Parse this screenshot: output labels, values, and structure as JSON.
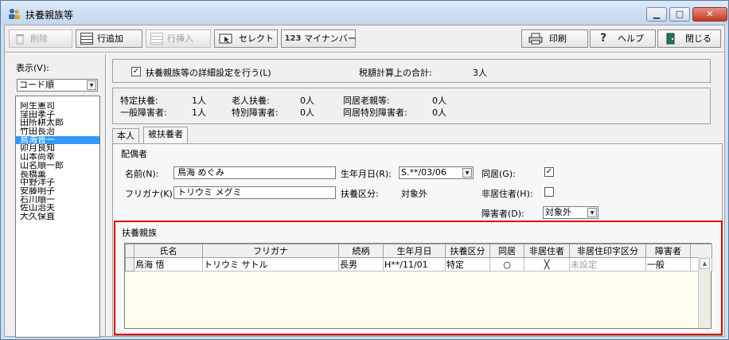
{
  "window": {
    "title": "扶養親族等",
    "icon": "app-icon",
    "controls": {
      "minimize": "▁",
      "maximize": "□",
      "close": "✕"
    }
  },
  "toolbar": {
    "delete": "削除",
    "add_row": "行追加",
    "insert_row": "行挿入",
    "select": "セレクト",
    "mynumber_prefix": "123",
    "mynumber": "マイナンバー",
    "print": "印刷",
    "help": "ヘルプ",
    "close": "閉じる"
  },
  "sidebar": {
    "display_label": "表示(V):",
    "sort_value": "コード順",
    "selected_index": 4,
    "employees": [
      "阿生憲司",
      "窪田孝子",
      "田所耕太郎",
      "竹田長治",
      "鳥海晋一",
      "卯月良知",
      "山本尚幸",
      "山名順一郎",
      "長橋薫",
      "中野洋子",
      "安藤明子",
      "石川順一",
      "佐山治夫",
      "大久保直"
    ]
  },
  "settings": {
    "detail_checked": true,
    "detail_label": "扶養親族等の詳細設定を行う(L)",
    "tax_total_label": "税額計算上の合計:",
    "tax_total_value": "3人"
  },
  "summary": {
    "tokutei_label": "特定扶養:",
    "tokutei_value": "1人",
    "roujin_label": "老人扶養:",
    "roujin_value": "0人",
    "doukyo_rouoya_label": "同居老親等:",
    "doukyo_rouoya_value": "0人",
    "ippan_label": "一般障害者:",
    "ippan_value": "1人",
    "tokubetsu_label": "特別障害者:",
    "tokubetsu_value": "0人",
    "doukyo_tokubetsu_label": "同居特別障害者:",
    "doukyo_tokubetsu_value": "0人"
  },
  "tabs": [
    "本人",
    "被扶養者"
  ],
  "spouse": {
    "section_title": "配偶者",
    "name_label": "名前(N):",
    "name_value": "鳥海 めぐみ",
    "kana_label": "フリガナ(K):",
    "kana_value": "トリウミ メグミ",
    "birth_label": "生年月日(R):",
    "birth_value": "S.**/03/06",
    "fuyou_kubun_label": "扶養区分:",
    "fuyou_kubun_value": "対象外",
    "doukyo_label": "同居(G):",
    "doukyo_checked": true,
    "nonresident_label": "非居住者(H):",
    "nonresident_checked": false,
    "disability_label": "障害者(D):",
    "disability_value": "対象外"
  },
  "dependents": {
    "section_title": "扶養親族",
    "headers": [
      "氏名",
      "フリガナ",
      "続柄",
      "生年月日",
      "扶養区分",
      "同居",
      "非居住者",
      "非居住印字区分",
      "障害者"
    ],
    "rows": [
      {
        "name": "鳥海 悟",
        "kana": "トリウミ サトル",
        "relation": "長男",
        "birth": "H**/11/01",
        "kubun": "特定",
        "doukyo": "○",
        "nonresident": "╳",
        "print_kubun": "未設定",
        "disability": "一般"
      }
    ]
  },
  "colors": {
    "accent_highlight": "#e00000",
    "selection": "#3399ff",
    "title_bar": "#c3d7ef"
  }
}
